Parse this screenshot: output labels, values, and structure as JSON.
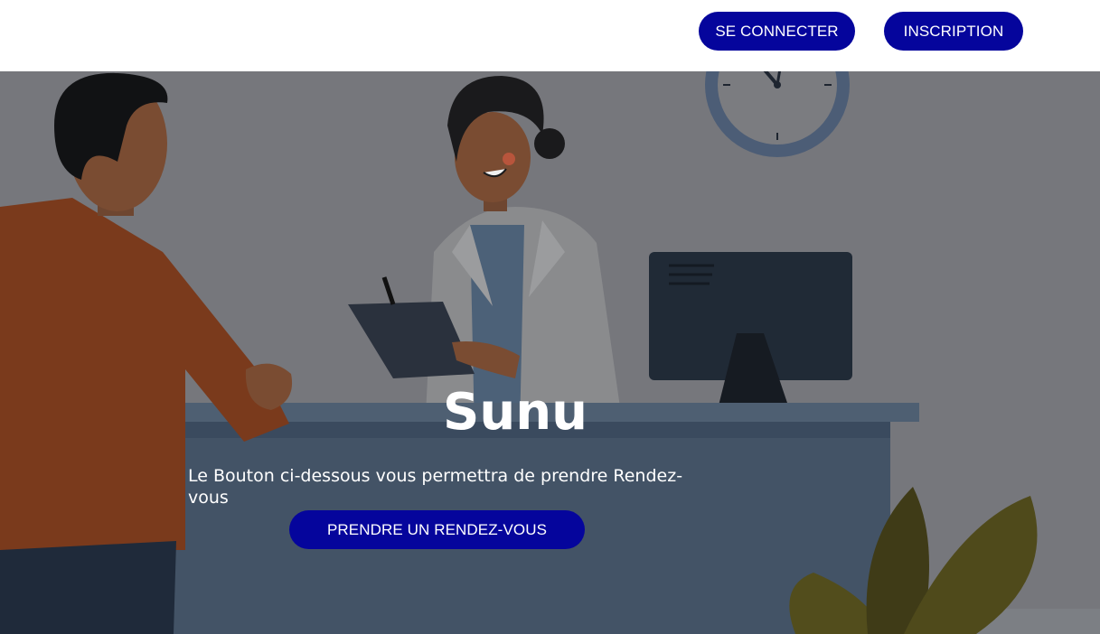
{
  "header": {
    "login_label": "SE CONNECTER",
    "register_label": "INSCRIPTION"
  },
  "hero": {
    "title": "Sunu",
    "subtitle": "Le Bouton ci-dessous vous permettra de prendre Rendez-vous",
    "cta_label": "PRENDRE UN RENDEZ-VOUS"
  },
  "colors": {
    "accent": "#05059c",
    "overlay": "#76777c"
  }
}
